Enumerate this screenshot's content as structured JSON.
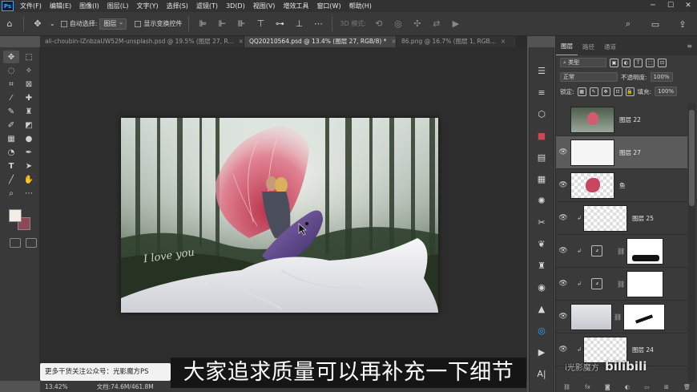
{
  "menubar": {
    "logo": "Ps",
    "items": [
      "文件(F)",
      "编辑(E)",
      "图像(I)",
      "图层(L)",
      "文字(Y)",
      "选择(S)",
      "滤镜(T)",
      "3D(D)",
      "视图(V)",
      "增效工具",
      "窗口(W)",
      "帮助(H)"
    ]
  },
  "optbar": {
    "auto_select": "自动选择:",
    "target": "图层",
    "show_transform": "显示变换控件",
    "mode3d": "3D 模式:"
  },
  "tabs": [
    {
      "title": "ali-choubin-IZnbzaUW52M-unsplash.psd @ 19.5% (图层 27, R...",
      "close": "×"
    },
    {
      "title": "QQ20210564.psd @ 13.4% (图层 27, RGB/8) *",
      "close": "×"
    },
    {
      "title": "86.png @ 16.7% (图层 1, RGB...",
      "close": "×"
    }
  ],
  "artwork": {
    "script_text": "I love you"
  },
  "status": {
    "zoom": "13.42%",
    "doc": "文档:74.6M/461.8M"
  },
  "promo": "更多干货关注公众号：光影魔方PS",
  "subtitle": "大家追求质量可以再补充一下细节",
  "panel": {
    "tabs": [
      "图层",
      "路径",
      "通道"
    ],
    "filter_type": "类型",
    "blend_mode": "正常",
    "opacity_label": "不透明度:",
    "opacity_value": "100%",
    "lock_label": "锁定:",
    "fill_label": "填充:",
    "fill_value": "100%"
  },
  "layers": [
    {
      "name": "图层 22"
    },
    {
      "name": "图层 27"
    },
    {
      "name": "鱼"
    },
    {
      "name": "图层 25"
    },
    {
      "name": ""
    },
    {
      "name": ""
    },
    {
      "name": ""
    },
    {
      "name": "图层 24"
    }
  ],
  "watermark": {
    "left": "i光影魔方",
    "right": "bilibili"
  },
  "colors": {
    "foreground": "#f2ede6",
    "background": "#8e4759",
    "accent": "#31a8ff"
  }
}
